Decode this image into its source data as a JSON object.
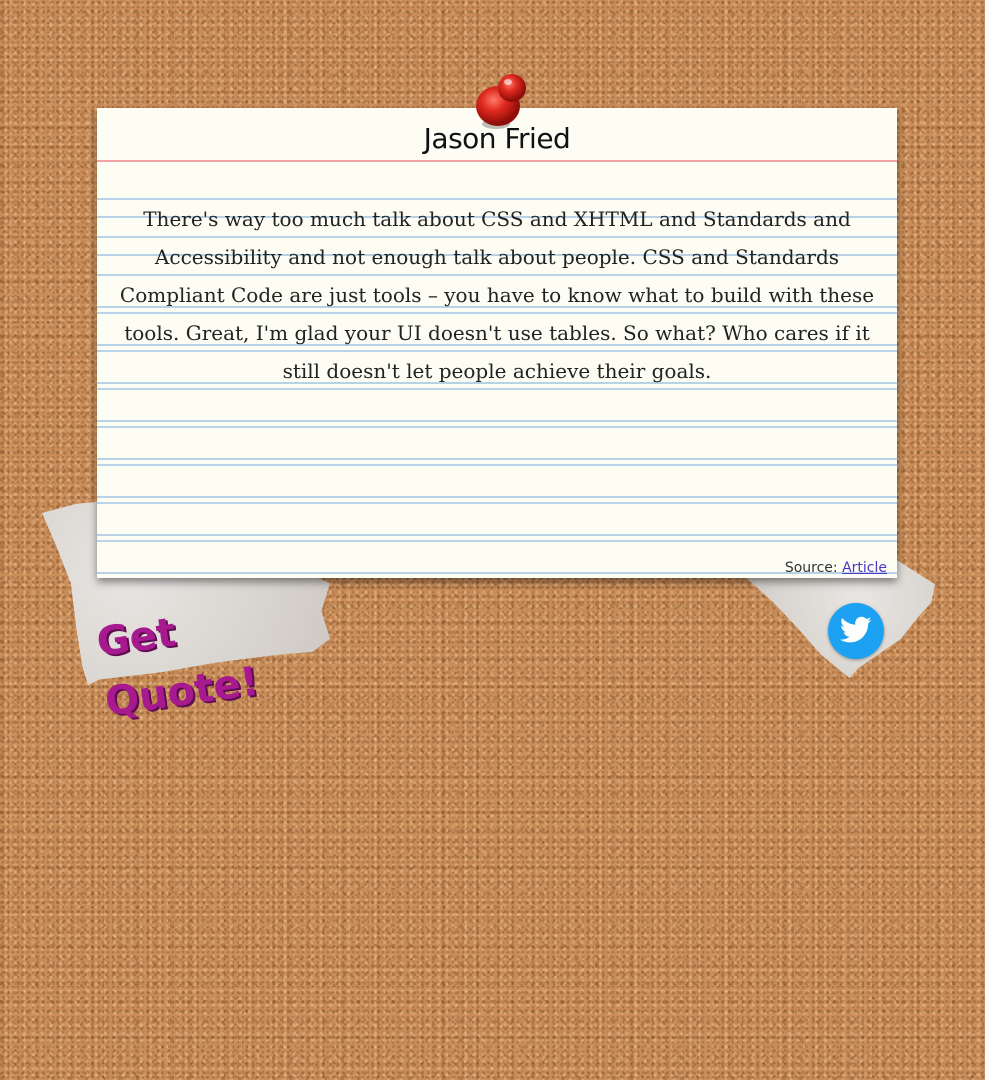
{
  "quote": {
    "author": "Jason Fried",
    "text": "There's way too much talk about CSS and XHTML and Standards and Accessibility and not enough talk about people. CSS and Standards Compliant Code are just tools – you have to know what to build with these tools. Great, I'm glad your UI doesn't use tables. So what? Who cares if it still doesn't let people achieve their goals.",
    "source_label": "Source:",
    "source_link_text": "Article"
  },
  "actions": {
    "get_quote_label": "Get Quote!",
    "twitter_icon": "twitter-bird-icon"
  },
  "colors": {
    "cork": "#c98d5a",
    "card": "#fdfdf3",
    "red_rule": "#f0a2a6",
    "blue_rule": "#b9d3ea",
    "get_quote": "#a71a8f",
    "twitter": "#1da1f2",
    "pin": "#d11f18"
  }
}
